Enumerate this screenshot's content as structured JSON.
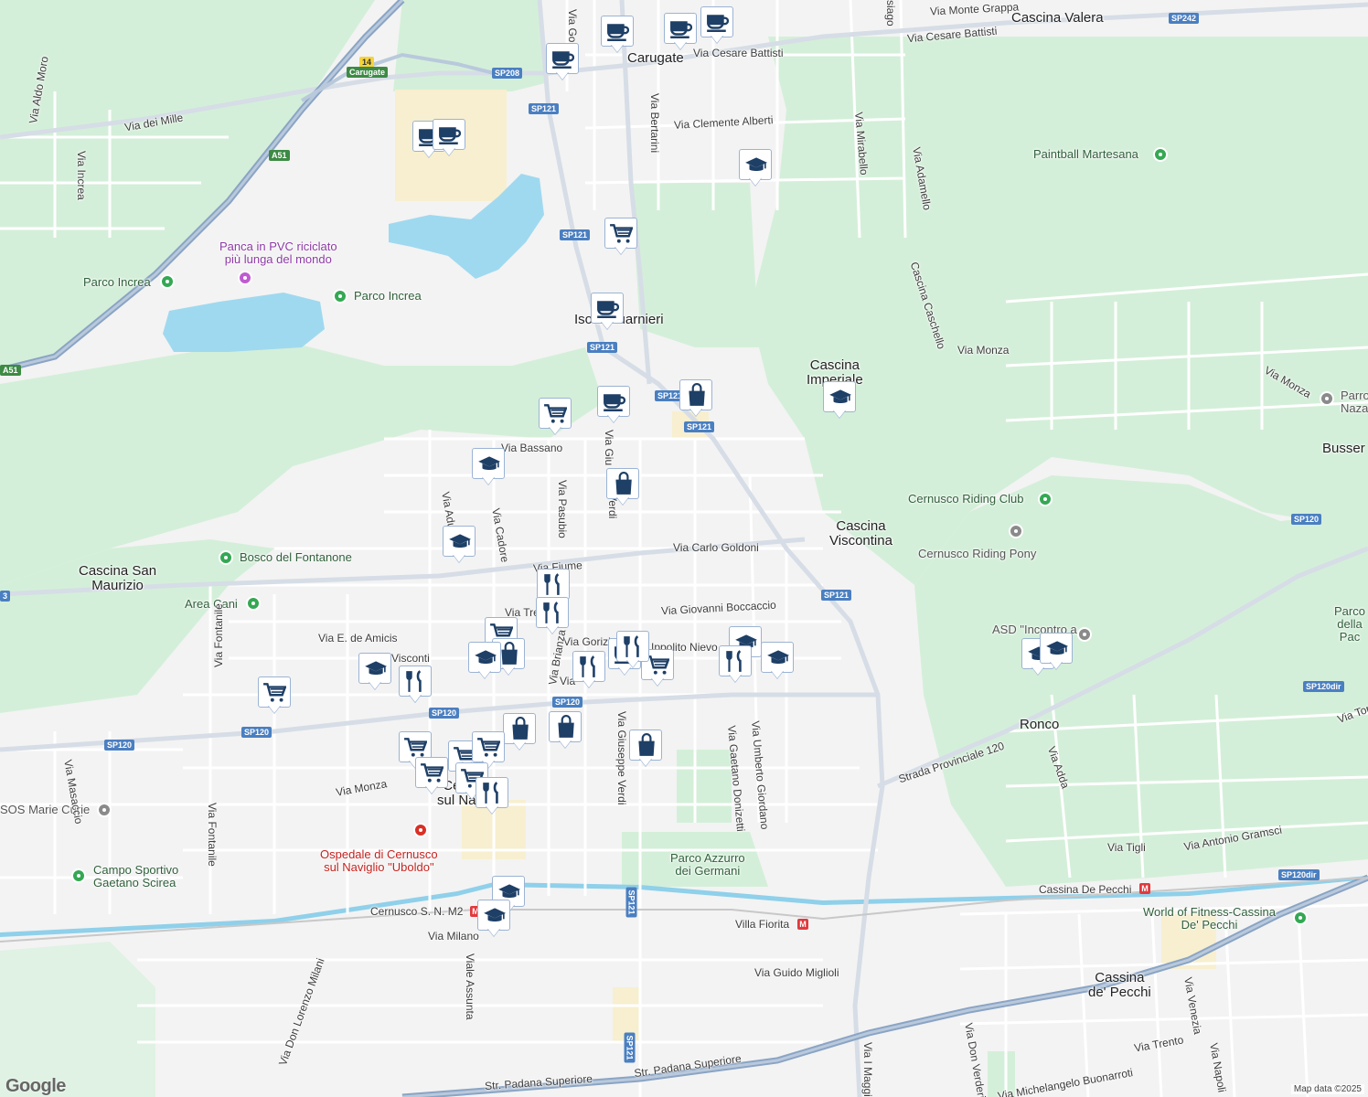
{
  "map": {
    "attribution": "Map data ©2025",
    "logo": "Google",
    "colors": {
      "land": "#f3f3f3",
      "park": "#d4efd9",
      "water": "#9fd9f0",
      "road": "#ffffff",
      "highway": "#8aa4c4",
      "pin_icon": "#1e3f66"
    }
  },
  "place_labels": [
    {
      "id": "carugate",
      "text": "Carugate"
    },
    {
      "id": "cascina-valera",
      "text": "Cascina Valera"
    },
    {
      "id": "cascina-imperiale",
      "text": "Cascina\nImperiale"
    },
    {
      "id": "cascina-viscontina",
      "text": "Cascina\nViscontina"
    },
    {
      "id": "cascina-san-maurizio",
      "text": "Cascina San\nMaurizio"
    },
    {
      "id": "ronco",
      "text": "Ronco"
    },
    {
      "id": "cassina-de-pecchi",
      "text": "Cassina\nde' Pecchi"
    },
    {
      "id": "bussero",
      "text": "Busser"
    },
    {
      "id": "isola-guarnieri",
      "text": "Isola Guarnieri"
    },
    {
      "id": "cernusco",
      "text": "Cernusco\nsul Naviglio"
    }
  ],
  "poi_labels": [
    {
      "id": "panca",
      "text": "Panca in PVC riciclato\npiù lunga del mondo",
      "icon": "camera-icon"
    },
    {
      "id": "parco-increa-1",
      "text": "Parco Increa",
      "icon": "tree-icon"
    },
    {
      "id": "parco-increa-2",
      "text": "Parco Increa",
      "icon": "tree-icon"
    },
    {
      "id": "bosco-fontanone",
      "text": "Bosco del Fontanone",
      "icon": "tree-icon"
    },
    {
      "id": "area-cani",
      "text": "Area Cani",
      "icon": "tree-icon"
    },
    {
      "id": "paintball",
      "text": "Paintball Martesana",
      "icon": "sport-icon"
    },
    {
      "id": "riding-club",
      "text": "Cernusco Riding Club",
      "icon": "sport-icon"
    },
    {
      "id": "riding-pony",
      "text": "Cernusco Riding Pony",
      "icon": "school-icon"
    },
    {
      "id": "asd",
      "text": "ASD \"Incontro a",
      "icon": "sport-icon"
    },
    {
      "id": "sos-marie-curie",
      "text": "SOS Marie Curie",
      "icon": "school-icon"
    },
    {
      "id": "campo-sportivo",
      "text": "Campo Sportivo\nGaetano Scirea",
      "icon": "sport-icon"
    },
    {
      "id": "parco-azzurro",
      "text": "Parco Azzurro\ndei Germani",
      "icon": "tree-icon"
    },
    {
      "id": "world-fitness",
      "text": "World of Fitness-Cassina\nDe' Pecchi",
      "icon": "sport-icon"
    },
    {
      "id": "parco-pace",
      "text": "Parco\ndella Pac",
      "icon": "tree-icon"
    },
    {
      "id": "parrocchia",
      "text": "Parro\nNaza",
      "icon": "church-icon"
    },
    {
      "id": "ospedale",
      "text": "Ospedale di Cernusco\nsul Naviglio \"Uboldo\"",
      "icon": "hospital-icon"
    },
    {
      "id": "cernusco-m2",
      "text": "Cernusco S. N. M2",
      "icon": "metro-icon"
    },
    {
      "id": "villa-fiorita",
      "text": "Villa Fiorita",
      "icon": "metro-icon"
    },
    {
      "id": "cassina-de-pecchi-m",
      "text": "Cassina De Pecchi",
      "icon": "metro-icon"
    }
  ],
  "street_labels": [
    {
      "id": "via-monte-grappa",
      "text": "Via Monte Grappa"
    },
    {
      "id": "via-cesare-battisti-1",
      "text": "Via Cesare Battisti"
    },
    {
      "id": "via-cesare-battisti-2",
      "text": "Via Cesare Battisti"
    },
    {
      "id": "via-dei-mille",
      "text": "Via dei Mille"
    },
    {
      "id": "via-aldo-moro",
      "text": "Via Aldo Moro"
    },
    {
      "id": "via-increa",
      "text": "Via Increa"
    },
    {
      "id": "via-bertarini",
      "text": "Via Bertarini"
    },
    {
      "id": "via-clemente-alberti",
      "text": "Via Clemente Alberti"
    },
    {
      "id": "via-mirabello",
      "text": "Via Mirabello"
    },
    {
      "id": "via-adamello",
      "text": "Via Adamello"
    },
    {
      "id": "cascina-caschello",
      "text": "Cascina Caschello"
    },
    {
      "id": "via-monza-1",
      "text": "Via Monza"
    },
    {
      "id": "via-monza-2",
      "text": "Via Monza"
    },
    {
      "id": "via-monza-3",
      "text": "Via Monza"
    },
    {
      "id": "via-bassano",
      "text": "Via Bassano"
    },
    {
      "id": "via-adua",
      "text": "Via Adua"
    },
    {
      "id": "via-cadore",
      "text": "Via Cadore"
    },
    {
      "id": "via-pasubio",
      "text": "Via Pasubio"
    },
    {
      "id": "via-verdi-short",
      "text": "Verdi"
    },
    {
      "id": "via-carlo-goldoni",
      "text": "Via Carlo Goldoni"
    },
    {
      "id": "via-fiume",
      "text": "Via Fiume"
    },
    {
      "id": "via-giovanni-boccaccio",
      "text": "Via Giovanni Boccaccio"
    },
    {
      "id": "via-e-de-amicis",
      "text": "Via E. de Amicis"
    },
    {
      "id": "via-gorizia",
      "text": "Via Gorizia"
    },
    {
      "id": "via-ippolito-nievo",
      "text": "Ippolito Nievo"
    },
    {
      "id": "via-brianza",
      "text": "Via Brianza"
    },
    {
      "id": "via-fontanile-1",
      "text": "Via Fontanile"
    },
    {
      "id": "via-fontanile-2",
      "text": "Via Fontanile"
    },
    {
      "id": "via-masaccio",
      "text": "Via Masaccio"
    },
    {
      "id": "via-giuseppe-verdi",
      "text": "Via Giuseppe Verdi"
    },
    {
      "id": "via-gaetano-donizetti",
      "text": "Via Gaetano Donizetti"
    },
    {
      "id": "via-umberto-giordano",
      "text": "Via Umberto Giordano"
    },
    {
      "id": "strada-provinciale-120",
      "text": "Strada Provinciale 120"
    },
    {
      "id": "via-adda",
      "text": "Via Adda"
    },
    {
      "id": "via-tigli",
      "text": "Via Tigli"
    },
    {
      "id": "via-antonio-gramsci",
      "text": "Via Antonio Gramsci"
    },
    {
      "id": "via-milano",
      "text": "Via Milano"
    },
    {
      "id": "viale-assunta",
      "text": "Viale Assunta"
    },
    {
      "id": "via-guido-miglioli",
      "text": "Via Guido Miglioli"
    },
    {
      "id": "via-don-lorenzo-milani",
      "text": "Via Don Lorenzo Milani"
    },
    {
      "id": "str-padana-superiore-1",
      "text": "Str. Padana Superiore"
    },
    {
      "id": "str-padana-superiore-2",
      "text": "Str. Padana Superiore"
    },
    {
      "id": "via-trento",
      "text": "Via Trento"
    },
    {
      "id": "via-michelangelo",
      "text": "Via Michelangelo Buonarroti"
    },
    {
      "id": "via-napoli",
      "text": "Via Napoli"
    },
    {
      "id": "via-venezia",
      "text": "Via Venezia"
    },
    {
      "id": "via-don-verderio",
      "text": "Via Don Verderio"
    },
    {
      "id": "via-maggi",
      "text": "Via I Maggi"
    },
    {
      "id": "via-tre",
      "text": "Via Tre"
    },
    {
      "id": "via-visconti",
      "text": "Visconti"
    },
    {
      "id": "via-giu",
      "text": "Via Giu"
    },
    {
      "id": "via-gor",
      "text": "Via Gor"
    },
    {
      "id": "via-tor",
      "text": "Via Tor"
    },
    {
      "id": "siago",
      "text": "siago"
    },
    {
      "id": "via-short",
      "text": "Via"
    }
  ],
  "road_shields": [
    {
      "id": "sp242",
      "text": "SP242"
    },
    {
      "id": "sp208",
      "text": "SP208"
    },
    {
      "id": "sp121-a",
      "text": "SP121"
    },
    {
      "id": "sp121-b",
      "text": "SP121"
    },
    {
      "id": "sp121-c",
      "text": "SP121"
    },
    {
      "id": "sp121-d",
      "text": "SP121"
    },
    {
      "id": "sp121-e",
      "text": "SP121"
    },
    {
      "id": "sp121-f",
      "text": "SP121"
    },
    {
      "id": "sp121-g",
      "text": "SP121"
    },
    {
      "id": "sp121-h",
      "text": "SP121"
    },
    {
      "id": "sp120-a",
      "text": "SP120"
    },
    {
      "id": "sp120-b",
      "text": "SP120"
    },
    {
      "id": "sp120-c",
      "text": "SP120"
    },
    {
      "id": "sp120-d",
      "text": "SP120"
    },
    {
      "id": "sp120-e",
      "text": "SP120"
    },
    {
      "id": "sp120dir-a",
      "text": "SP120dir"
    },
    {
      "id": "sp120dir-b",
      "text": "SP120dir"
    },
    {
      "id": "a51-a",
      "text": "A51"
    },
    {
      "id": "a51-b",
      "text": "A51"
    },
    {
      "id": "exit-14",
      "text": "14"
    },
    {
      "id": "exit-carugate",
      "text": "Carugate"
    },
    {
      "id": "p3",
      "text": "3"
    }
  ],
  "pins": [
    {
      "type": "cafe"
    },
    {
      "type": "cafe"
    },
    {
      "type": "cafe"
    },
    {
      "type": "cafe"
    },
    {
      "type": "cafe"
    },
    {
      "type": "cafe"
    },
    {
      "type": "school"
    },
    {
      "type": "shopping-cart"
    },
    {
      "type": "cafe"
    },
    {
      "type": "shopping-bag"
    },
    {
      "type": "school"
    },
    {
      "type": "shopping-cart"
    },
    {
      "type": "cafe"
    },
    {
      "type": "school"
    },
    {
      "type": "shopping-bag"
    },
    {
      "type": "school"
    },
    {
      "type": "restaurant"
    },
    {
      "type": "restaurant"
    },
    {
      "type": "shopping-cart"
    },
    {
      "type": "shopping-bag"
    },
    {
      "type": "school"
    },
    {
      "type": "school"
    },
    {
      "type": "restaurant"
    },
    {
      "type": "shopping-cart"
    },
    {
      "type": "restaurant"
    },
    {
      "type": "cafe"
    },
    {
      "type": "shopping-cart"
    },
    {
      "type": "school"
    },
    {
      "type": "restaurant"
    },
    {
      "type": "school"
    },
    {
      "type": "school"
    },
    {
      "type": "school"
    },
    {
      "type": "shopping-bag"
    },
    {
      "type": "shopping-bag"
    },
    {
      "type": "shopping-cart"
    },
    {
      "type": "shopping-cart"
    },
    {
      "type": "shopping-cart"
    },
    {
      "type": "shopping-cart"
    },
    {
      "type": "shopping-cart"
    },
    {
      "type": "shopping-cart"
    },
    {
      "type": "restaurant"
    },
    {
      "type": "school"
    },
    {
      "type": "school"
    },
    {
      "type": "shopping-bag"
    },
    {
      "type": "restaurant"
    }
  ]
}
